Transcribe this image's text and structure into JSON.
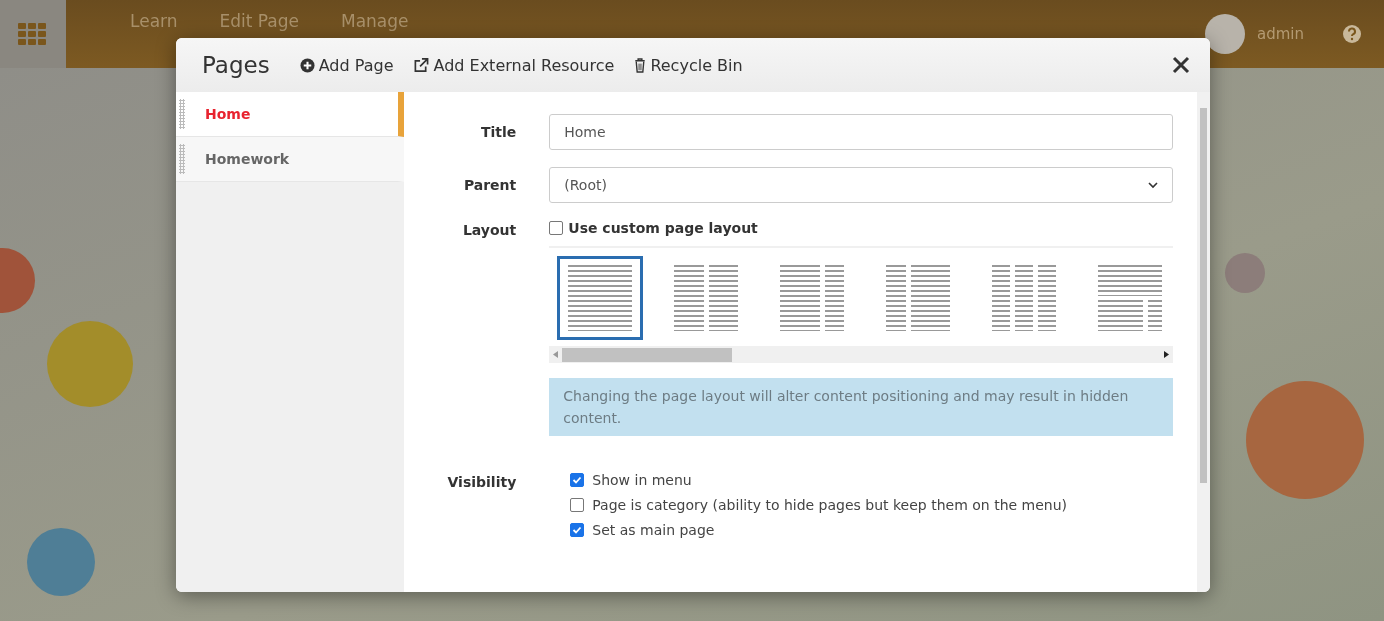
{
  "top_bar": {
    "nav": [
      {
        "label": "Learn"
      },
      {
        "label": "Edit Page"
      },
      {
        "label": "Manage"
      }
    ],
    "user": "admin"
  },
  "dialog": {
    "title": "Pages",
    "actions": [
      {
        "label": "Add Page",
        "kind": "add"
      },
      {
        "label": "Add External Resource",
        "kind": "external"
      },
      {
        "label": "Recycle Bin",
        "kind": "bin"
      }
    ]
  },
  "pages": [
    {
      "label": "Home",
      "selected": true
    },
    {
      "label": "Homework",
      "selected": false
    }
  ],
  "form": {
    "title_label": "Title",
    "title_value": "Home",
    "parent_label": "Parent",
    "parent_value": "(Root)",
    "layout_label": "Layout",
    "custom_layout": {
      "label": "Use custom page layout",
      "checked": false
    },
    "layouts": [
      {
        "kind": "one",
        "selected": true
      },
      {
        "kind": "two",
        "selected": false
      },
      {
        "kind": "wide-narrow",
        "selected": false
      },
      {
        "kind": "narrow-wide",
        "selected": false
      },
      {
        "kind": "three",
        "selected": false
      },
      {
        "kind": "stacked",
        "selected": false
      }
    ],
    "notice": "Changing the page layout will alter content positioning and may result in hidden content.",
    "visibility_label": "Visibility",
    "visibility": [
      {
        "label": "Show in menu",
        "checked": true
      },
      {
        "label": "Page is category (ability to hide pages but keep them on the menu)",
        "checked": false
      },
      {
        "label": "Set as main page",
        "checked": true
      }
    ]
  }
}
